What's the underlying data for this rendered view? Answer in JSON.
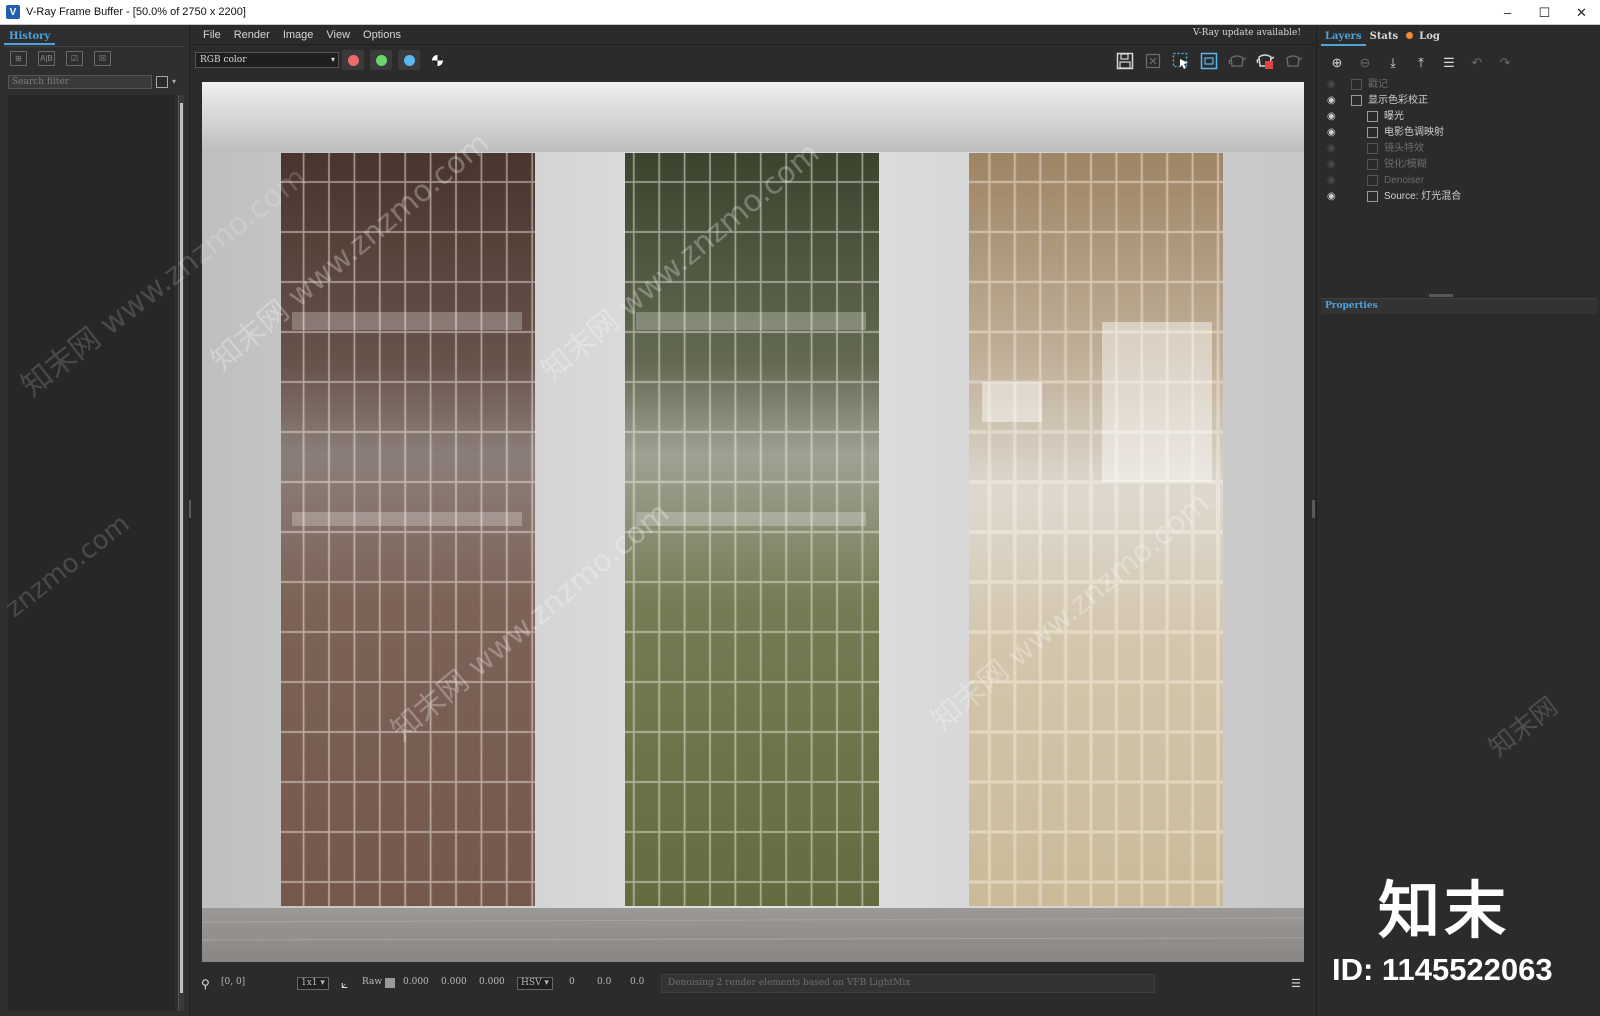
{
  "window": {
    "title": "V-Ray Frame Buffer - [50.0% of 2750 x 2200]",
    "minimize": "–",
    "maximize": "☐",
    "close": "✕"
  },
  "history": {
    "tab_label": "History",
    "search_placeholder": "Search filter",
    "tools": [
      "⊞",
      "A|B",
      "☑",
      "☒"
    ]
  },
  "menu": {
    "items": [
      "File",
      "Render",
      "Image",
      "View",
      "Options"
    ],
    "update_notice": "V-Ray update available!"
  },
  "toolbar": {
    "channel": "RGB color",
    "colors": {
      "red": "#f06a6a",
      "green": "#69d56a",
      "blue": "#5ab8f0"
    }
  },
  "statusbar": {
    "coords": "[0, 0]",
    "zoom": "1x1",
    "mode_label": "Raw",
    "vals": [
      "0.000",
      "0.000",
      "0.000"
    ],
    "color_space": "HSV",
    "hsv_vals": [
      "0",
      "0.0",
      "0.0"
    ],
    "message": "Denoising 2 render elements based on VFB LightMix"
  },
  "right": {
    "tabs": [
      "Layers",
      "Stats",
      "Log"
    ],
    "layers": [
      {
        "label": "戳记",
        "visible": false,
        "indent": 1,
        "dim": true
      },
      {
        "label": "显示色彩校正",
        "visible": true,
        "indent": 1,
        "dim": false
      },
      {
        "label": "曝光",
        "visible": true,
        "indent": 2,
        "dim": false
      },
      {
        "label": "电影色调映射",
        "visible": true,
        "indent": 2,
        "dim": false
      },
      {
        "label": "镜头特效",
        "visible": false,
        "indent": 2,
        "dim": true
      },
      {
        "label": "锐化/模糊",
        "visible": false,
        "indent": 2,
        "dim": true
      },
      {
        "label": "Denoiser",
        "visible": false,
        "indent": 2,
        "dim": true
      },
      {
        "label": "Source: 灯光混合",
        "visible": true,
        "indent": 2,
        "dim": false
      }
    ],
    "properties_label": "Properties"
  },
  "watermark": {
    "brand": "知末",
    "id_text": "ID: 1145522063",
    "site": "知末网 www.znzmo.com",
    "site_short": "znzmo.com"
  },
  "render": {
    "tiles": [
      {
        "top": "#5a4038",
        "mid": "#8a7870",
        "bottom": "#7a5a4c"
      },
      {
        "top": "#4a5236",
        "mid": "#a6aa98",
        "bottom": "#6c7444"
      },
      {
        "top": "#b49a78",
        "mid": "#e6dccc",
        "bottom": "#d8c8a4"
      }
    ]
  }
}
